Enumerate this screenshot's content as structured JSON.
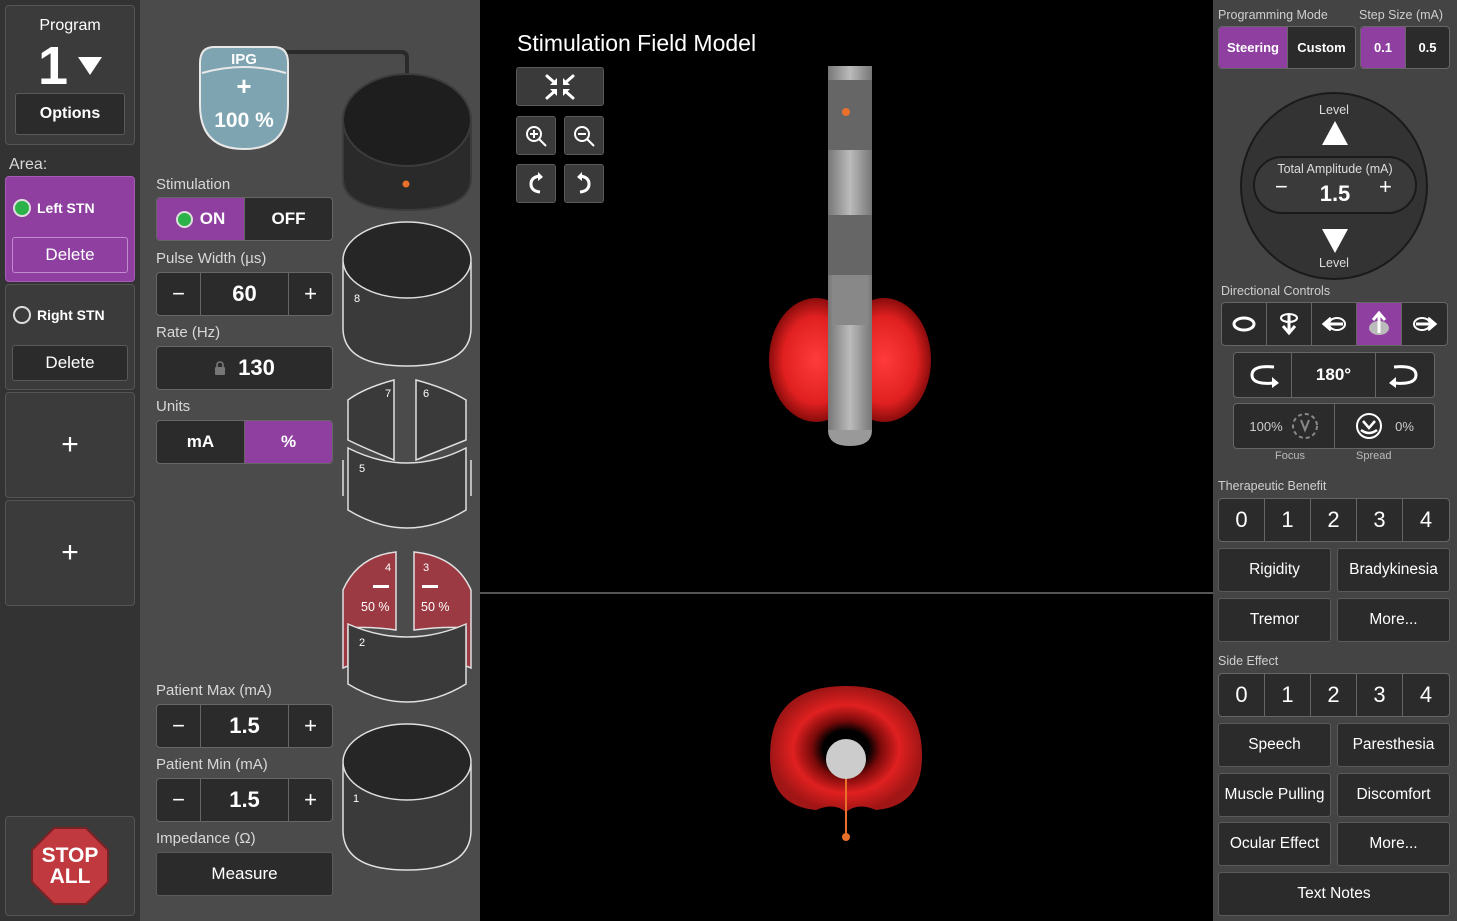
{
  "program": {
    "label": "Program",
    "number": "1",
    "options_label": "Options"
  },
  "area": {
    "label": "Area:",
    "items": [
      {
        "name": "Left STN",
        "delete_label": "Delete",
        "active": true
      },
      {
        "name": "Right STN",
        "delete_label": "Delete",
        "active": false
      }
    ],
    "add_label": "+"
  },
  "stop": {
    "line1": "STOP",
    "line2": "ALL"
  },
  "ipg": {
    "label": "IPG",
    "plus": "+",
    "percent": "100 %"
  },
  "stimulation": {
    "label": "Stimulation",
    "on_label": "ON",
    "off_label": "OFF",
    "state": "on"
  },
  "pulse_width": {
    "label": "Pulse Width (µs)",
    "value": "60",
    "minus": "−",
    "plus": "+"
  },
  "rate": {
    "label": "Rate (Hz)",
    "value": "130"
  },
  "units": {
    "label": "Units",
    "ma_label": "mA",
    "percent_label": "%",
    "selected": "%"
  },
  "patient_max": {
    "label": "Patient Max (mA)",
    "value": "1.5",
    "minus": "−",
    "plus": "+"
  },
  "patient_min": {
    "label": "Patient Min (mA)",
    "value": "1.5",
    "minus": "−",
    "plus": "+"
  },
  "impedance": {
    "label": "Impedance (Ω)",
    "measure_label": "Measure"
  },
  "lead": {
    "contacts": [
      {
        "id": "8"
      },
      {
        "id": "7"
      },
      {
        "id": "6"
      },
      {
        "id": "5"
      },
      {
        "id": "4",
        "value": "50 %"
      },
      {
        "id": "3",
        "value": "50 %"
      },
      {
        "id": "2"
      },
      {
        "id": "1"
      }
    ]
  },
  "model": {
    "title": "Stimulation Field Model"
  },
  "programming_mode": {
    "label": "Programming Mode",
    "steering": "Steering",
    "custom": "Custom",
    "selected": "Steering"
  },
  "step_size": {
    "label": "Step Size (mA)",
    "options": [
      "0.1",
      "0.5"
    ],
    "selected": "0.1"
  },
  "amplitude": {
    "level_up": "Level",
    "level_down": "Level",
    "label": "Total Amplitude (mA)",
    "value": "1.5",
    "minus": "−",
    "plus": "+"
  },
  "directional": {
    "label": "Directional Controls",
    "rotation": "180°",
    "focus_value": "100%",
    "focus_label": "Focus",
    "spread_value": "0%",
    "spread_label": "Spread"
  },
  "therapeutic": {
    "label": "Therapeutic Benefit",
    "scale": [
      "0",
      "1",
      "2",
      "3",
      "4"
    ],
    "items": [
      "Rigidity",
      "Bradykinesia",
      "Tremor",
      "More..."
    ]
  },
  "side_effect": {
    "label": "Side Effect",
    "scale": [
      "0",
      "1",
      "2",
      "3",
      "4"
    ],
    "items": [
      "Speech",
      "Paresthesia",
      "Muscle Pulling",
      "Discomfort",
      "Ocular Effect",
      "More..."
    ]
  },
  "text_notes": "Text Notes",
  "colors": {
    "accent": "#8e3fa0",
    "active_contact": "#9b3a42",
    "field": "#e02020",
    "green": "#2bb34a",
    "stop": "#c0393f"
  }
}
